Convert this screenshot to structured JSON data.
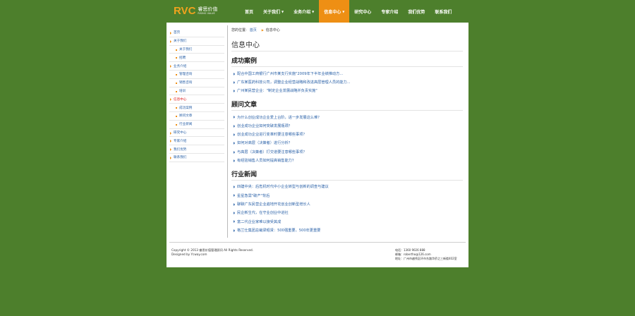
{
  "logo": {
    "mark": "RVC",
    "cn": "睿思价值",
    "en": "RISING VALUE"
  },
  "nav": [
    {
      "label": "首页",
      "caret": false,
      "active": false
    },
    {
      "label": "关于我们",
      "caret": true,
      "active": false
    },
    {
      "label": "业务介绍",
      "caret": true,
      "active": false
    },
    {
      "label": "信息中心",
      "caret": true,
      "active": true
    },
    {
      "label": "研究中心",
      "caret": false,
      "active": false
    },
    {
      "label": "专家介绍",
      "caret": false,
      "active": false
    },
    {
      "label": "我们优势",
      "caret": false,
      "active": false
    },
    {
      "label": "联系我们",
      "caret": false,
      "active": false
    }
  ],
  "sidebar": [
    {
      "label": "首页",
      "sub": false,
      "active": false
    },
    {
      "label": "关于我们",
      "sub": false,
      "active": false
    },
    {
      "label": "关于我们",
      "sub": true,
      "active": false
    },
    {
      "label": "招聘",
      "sub": true,
      "active": false
    },
    {
      "label": "业务介绍",
      "sub": false,
      "active": false
    },
    {
      "label": "管理咨询",
      "sub": true,
      "active": false
    },
    {
      "label": "销售咨询",
      "sub": true,
      "active": false
    },
    {
      "label": "培训",
      "sub": true,
      "active": false
    },
    {
      "label": "信息中心",
      "sub": false,
      "active": true
    },
    {
      "label": "成功案例",
      "sub": true,
      "active": false
    },
    {
      "label": "顾问文章",
      "sub": true,
      "active": false
    },
    {
      "label": "行业新闻",
      "sub": true,
      "active": false
    },
    {
      "label": "研究中心",
      "sub": false,
      "active": false
    },
    {
      "label": "专家介绍",
      "sub": false,
      "active": false
    },
    {
      "label": "我们优势",
      "sub": false,
      "active": false
    },
    {
      "label": "联系我们",
      "sub": false,
      "active": false
    }
  ],
  "breadcrumb": {
    "prefix": "您的位置:",
    "home": "首页",
    "current": "信息中心"
  },
  "page_title": "信息中心",
  "sections": [
    {
      "title": "成功案例",
      "items": [
        "配合中国工商银行广州市某支行实施\"2009年下半年业绩推动方...",
        "广东某医药科技公司，调整企业经营战略和改进高层管理人员的能力...",
        "广州某民营企业：\"制定企业发展战略并负责实施\""
      ]
    },
    {
      "title": "顾问文章",
      "items": [
        "为什么创业成功企业爱上台阶，进一步发展这么难？",
        "创业成功企业如何突破发展瓶颈？",
        "创业成功企业进行变革时要注意哪些事项？",
        "如何对高层（决策者）进行分析？",
        "与高层（决策者）打交道要注意哪些事项？",
        "有经验销售人员如何提高销售能力？"
      ]
    },
    {
      "title": "行业新闻",
      "items": [
        "四建中央：后危机时代中小企业转型与创新的调查与建议",
        "星星急需\"破产\"背后",
        "聊聊广东民营企业遍地开花创业创新型增长人",
        "民企新生代，在守业创业中进社",
        "富二代企业家难以接受其成",
        "格兰仕集团总裁梁昭贤：500强重要，500年更重要"
      ]
    }
  ],
  "footer": {
    "copyright": "Copyright © 2013  睿思价值管理顾问 All Rights Reserved.",
    "designed": "Designed by Ycway.com",
    "phone": "电话：1360 9026 888",
    "email": "邮箱：robertho@126.com",
    "address": "地址：广州市越秀区环市东路华侨之三新楼402室"
  }
}
